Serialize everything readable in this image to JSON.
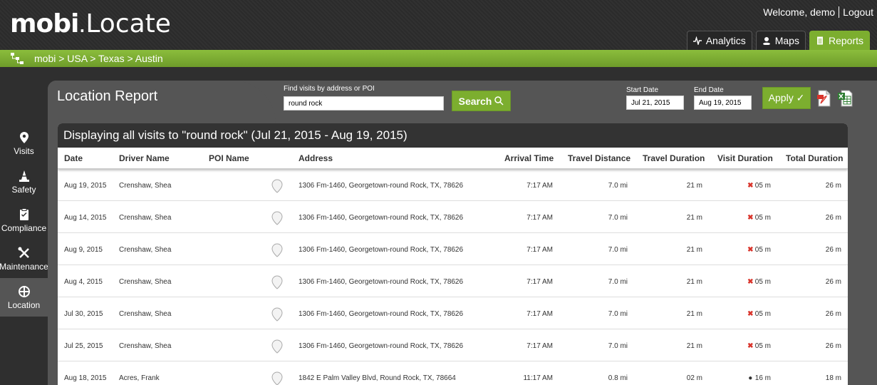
{
  "app": {
    "logo_mobi": "mobi",
    "logo_dot": ".",
    "logo_locate": "Locate"
  },
  "user": {
    "welcome": "Welcome, demo",
    "logout": "Logout"
  },
  "tabs": [
    {
      "label": "Analytics",
      "icon": "pulse-icon",
      "active": false
    },
    {
      "label": "Maps",
      "icon": "user-pin-icon",
      "active": false
    },
    {
      "label": "Reports",
      "icon": "document-icon",
      "active": true
    }
  ],
  "breadcrumb": "mobi > USA > Texas > Austin",
  "nav": [
    {
      "label": "Visits",
      "icon": "pin-icon"
    },
    {
      "label": "Safety",
      "icon": "cone-icon"
    },
    {
      "label": "Compliance",
      "icon": "clipboard-icon"
    },
    {
      "label": "Maintenance",
      "icon": "tools-icon"
    },
    {
      "label": "Location",
      "icon": "crosshair-icon",
      "active": true
    }
  ],
  "report": {
    "title": "Location Report",
    "search_label": "Find visits by address or POI",
    "search_value": "round rock",
    "search_button": "Search",
    "start_date_label": "Start Date",
    "start_date": "Jul 21, 2015",
    "end_date_label": "End Date",
    "end_date": "Aug 19, 2015",
    "apply_button": "Apply ✓",
    "table_title": "Displaying all visits to \"round rock\" (Jul 21, 2015 - Aug 19, 2015)",
    "columns": [
      "Date",
      "Driver Name",
      "POI Name",
      "Address",
      "Arrival Time",
      "Travel Distance",
      "Travel Duration",
      "Visit Duration",
      "Total Duration"
    ],
    "rows": [
      {
        "date": "Aug 19, 2015",
        "driver": "Crenshaw, Shea",
        "poi": "",
        "address": "1306 Fm-1460, Georgetown-round Rock, TX, 78626",
        "arrival": "7:17 AM",
        "distance": "7.0 mi",
        "travel_dur": "21 m",
        "visit_mark": "✖",
        "visit_dur": "05 m",
        "total": "26 m"
      },
      {
        "date": "Aug 14, 2015",
        "driver": "Crenshaw, Shea",
        "poi": "",
        "address": "1306 Fm-1460, Georgetown-round Rock, TX, 78626",
        "arrival": "7:17 AM",
        "distance": "7.0 mi",
        "travel_dur": "21 m",
        "visit_mark": "✖",
        "visit_dur": "05 m",
        "total": "26 m"
      },
      {
        "date": "Aug 9, 2015",
        "driver": "Crenshaw, Shea",
        "poi": "",
        "address": "1306 Fm-1460, Georgetown-round Rock, TX, 78626",
        "arrival": "7:17 AM",
        "distance": "7.0 mi",
        "travel_dur": "21 m",
        "visit_mark": "✖",
        "visit_dur": "05 m",
        "total": "26 m"
      },
      {
        "date": "Aug 4, 2015",
        "driver": "Crenshaw, Shea",
        "poi": "",
        "address": "1306 Fm-1460, Georgetown-round Rock, TX, 78626",
        "arrival": "7:17 AM",
        "distance": "7.0 mi",
        "travel_dur": "21 m",
        "visit_mark": "✖",
        "visit_dur": "05 m",
        "total": "26 m"
      },
      {
        "date": "Jul 30, 2015",
        "driver": "Crenshaw, Shea",
        "poi": "",
        "address": "1306 Fm-1460, Georgetown-round Rock, TX, 78626",
        "arrival": "7:17 AM",
        "distance": "7.0 mi",
        "travel_dur": "21 m",
        "visit_mark": "✖",
        "visit_dur": "05 m",
        "total": "26 m"
      },
      {
        "date": "Jul 25, 2015",
        "driver": "Crenshaw, Shea",
        "poi": "",
        "address": "1306 Fm-1460, Georgetown-round Rock, TX, 78626",
        "arrival": "7:17 AM",
        "distance": "7.0 mi",
        "travel_dur": "21 m",
        "visit_mark": "✖",
        "visit_dur": "05 m",
        "total": "26 m"
      },
      {
        "date": "Aug 18, 2015",
        "driver": "Acres, Frank",
        "poi": "",
        "address": "1842 E Palm Valley Blvd, Round Rock, TX, 78664",
        "arrival": "11:17 AM",
        "distance": "0.8 mi",
        "travel_dur": "02 m",
        "visit_mark": "●",
        "visit_dur": "16 m",
        "total": "18 m"
      }
    ]
  },
  "colors": {
    "accent": "#7cae2f",
    "header_bg": "#2b2b2b",
    "panel_bg": "#555555",
    "visit_x": "#d9342b"
  }
}
